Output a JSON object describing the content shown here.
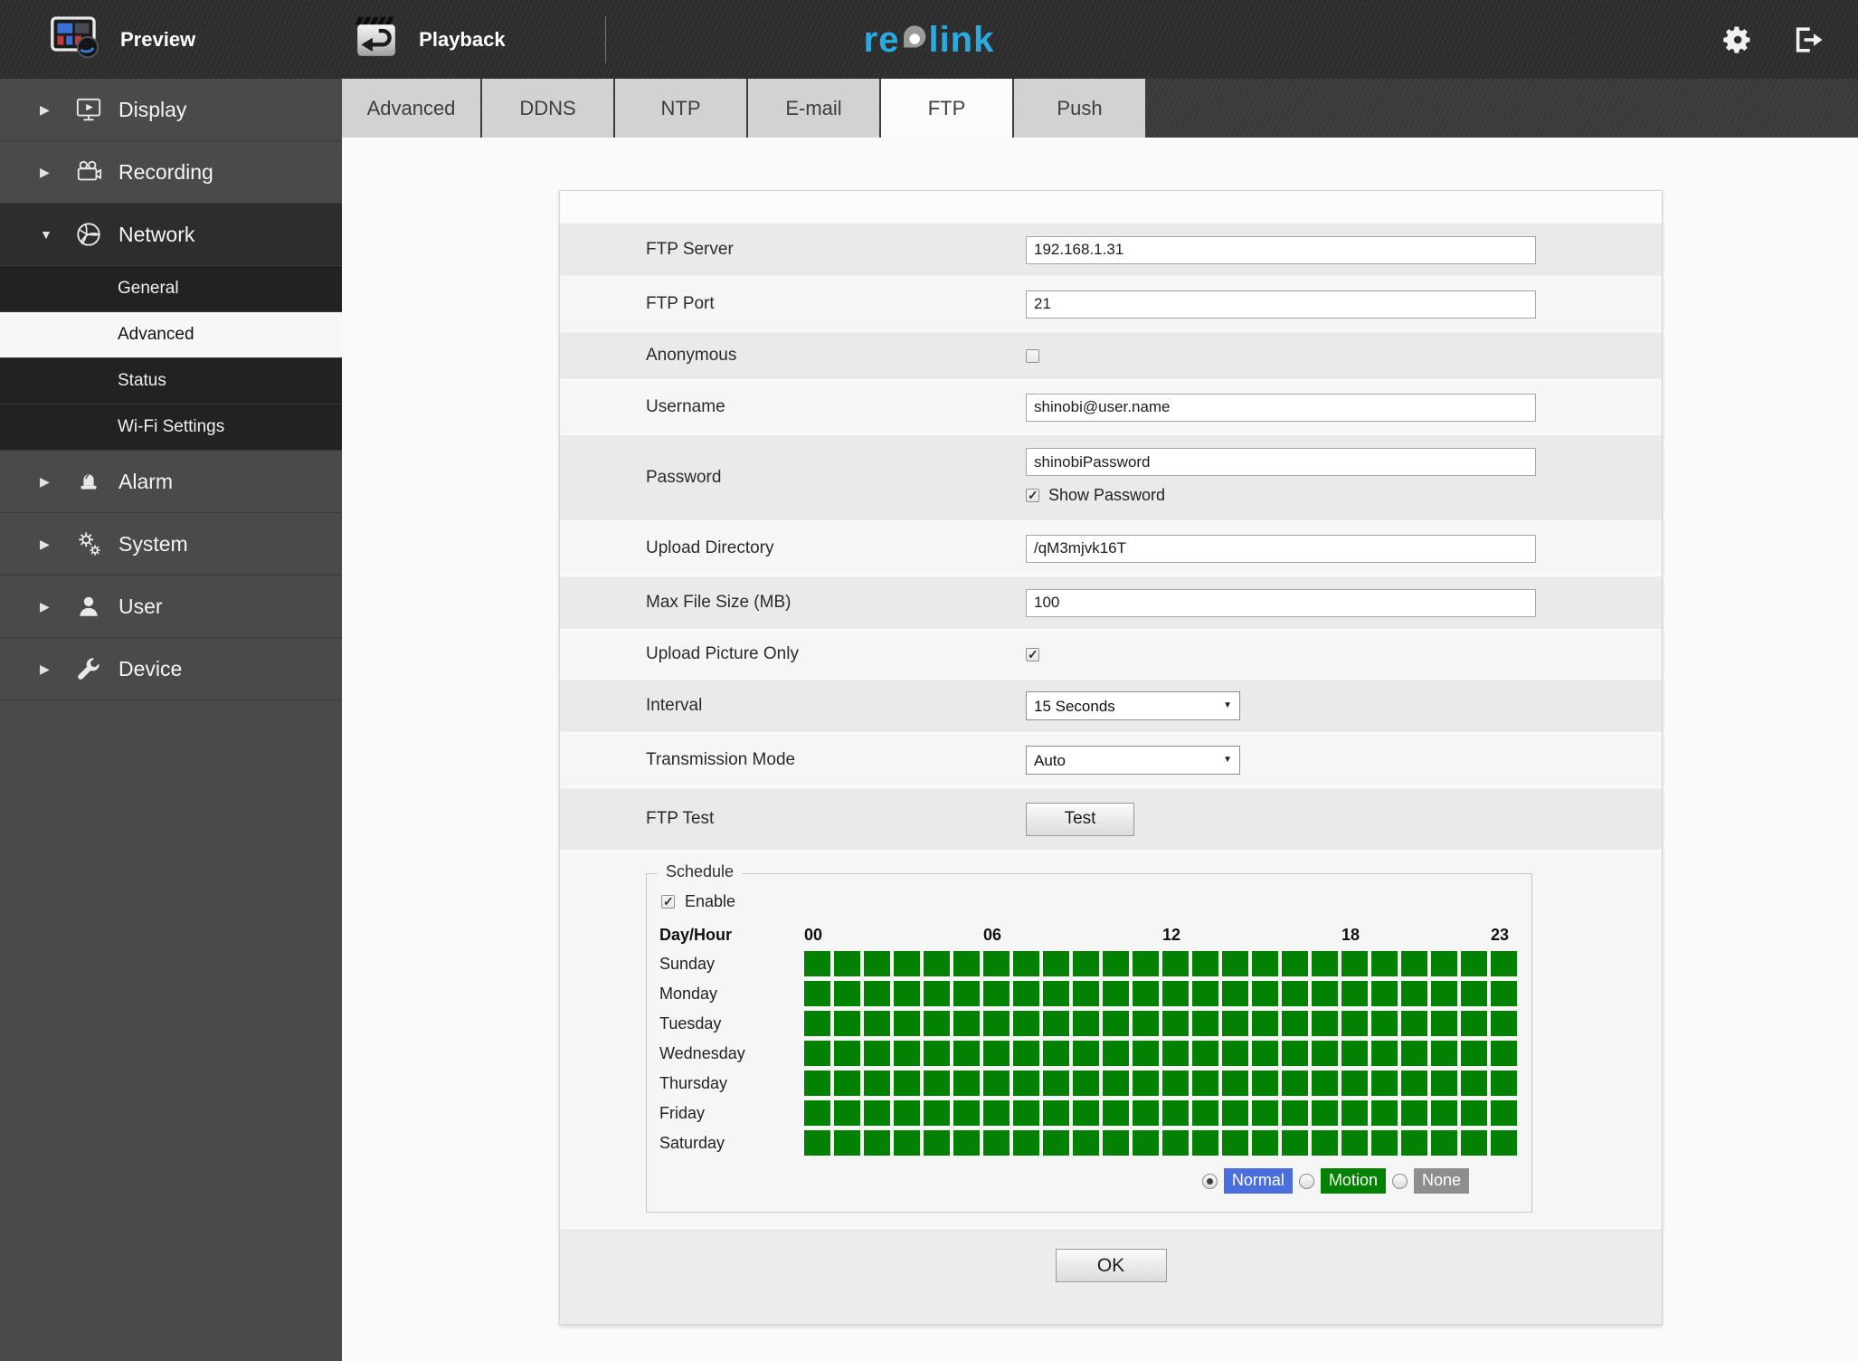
{
  "topbar": {
    "preview_label": "Preview",
    "playback_label": "Playback",
    "logo": {
      "re": "re",
      "link": "link"
    }
  },
  "sidebar": {
    "items": [
      {
        "label": "Display",
        "expanded": false
      },
      {
        "label": "Recording",
        "expanded": false
      },
      {
        "label": "Network",
        "expanded": true,
        "active": true,
        "children": [
          "General",
          "Advanced",
          "Status",
          "Wi-Fi Settings"
        ],
        "active_child": "Advanced"
      },
      {
        "label": "Alarm",
        "expanded": false
      },
      {
        "label": "System",
        "expanded": false
      },
      {
        "label": "User",
        "expanded": false
      },
      {
        "label": "Device",
        "expanded": false
      }
    ]
  },
  "tabs": {
    "items": [
      "Advanced",
      "DDNS",
      "NTP",
      "E-mail",
      "FTP",
      "Push"
    ],
    "active": "FTP"
  },
  "form": {
    "ftp_server_label": "FTP Server",
    "ftp_server_value": "192.168.1.31",
    "ftp_port_label": "FTP Port",
    "ftp_port_value": "21",
    "anonymous_label": "Anonymous",
    "anonymous_checked": false,
    "username_label": "Username",
    "username_value": "shinobi@user.name",
    "password_label": "Password",
    "password_value": "shinobiPassword",
    "show_password_label": "Show Password",
    "show_password_checked": true,
    "upload_directory_label": "Upload Directory",
    "upload_directory_value": "/qM3mjvk16T",
    "max_file_size_label": "Max File Size (MB)",
    "max_file_size_value": "100",
    "upload_picture_only_label": "Upload Picture Only",
    "upload_picture_only_checked": true,
    "interval_label": "Interval",
    "interval_value": "15 Seconds",
    "transmission_mode_label": "Transmission Mode",
    "transmission_mode_value": "Auto",
    "ftp_test_label": "FTP Test",
    "test_button_label": "Test"
  },
  "schedule": {
    "legend": "Schedule",
    "enable_label": "Enable",
    "enable_checked": true,
    "header_label": "Day/Hour",
    "hour_labels": [
      "00",
      "06",
      "12",
      "18",
      "23"
    ],
    "hour_label_cols": [
      0,
      6,
      12,
      18,
      23
    ],
    "days": [
      "Sunday",
      "Monday",
      "Tuesday",
      "Wednesday",
      "Thursday",
      "Friday",
      "Saturday"
    ],
    "hours_per_day": 24,
    "cell_state_all": "on",
    "cell_color": "#038103",
    "modes": [
      {
        "label": "Normal",
        "color": "#4a6fdc",
        "selected": true
      },
      {
        "label": "Motion",
        "color": "#038103",
        "selected": false
      },
      {
        "label": "None",
        "color": "#8e8e8e",
        "selected": false
      }
    ]
  },
  "ok_label": "OK",
  "colors": {
    "brand_blue": "#2baae1",
    "schedule_green": "#038103",
    "normal_blue": "#4a6fdc"
  }
}
